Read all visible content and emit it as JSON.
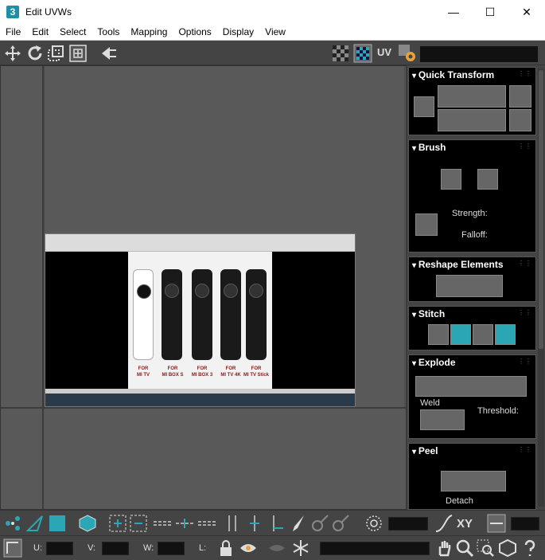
{
  "window": {
    "title": "Edit UVWs",
    "app_icon_letter": "3",
    "minimize": "—",
    "maximize": "☐",
    "close": "✕"
  },
  "menu": [
    "File",
    "Edit",
    "Select",
    "Tools",
    "Mapping",
    "Options",
    "Display",
    "View"
  ],
  "toolbar": {
    "uv_label": "UV"
  },
  "texture": {
    "labels": [
      "FOR\nMI TV",
      "FOR\nMI BOX S",
      "FOR\nMI BOX 3",
      "FOR\nMI TV 4K",
      "FOR\nMI TV Stick"
    ]
  },
  "rollouts": {
    "quick_transform": {
      "title": "Quick Transform"
    },
    "brush": {
      "title": "Brush",
      "strength_label": "Strength:",
      "falloff_label": "Falloff:"
    },
    "reshape": {
      "title": "Reshape Elements"
    },
    "stitch": {
      "title": "Stitch"
    },
    "explode": {
      "title": "Explode",
      "weld_label": "Weld",
      "threshold_label": "Threshold:"
    },
    "peel": {
      "title": "Peel",
      "detach_label": "Detach"
    }
  },
  "bottom": {
    "xy_label": "XY",
    "u_label": "U:",
    "v_label": "V:",
    "w_label": "W:",
    "l_label": "L:"
  },
  "colors": {
    "accent_teal": "#2aa6b5",
    "selection_orange": "#e8a23a",
    "viewport": "#595959"
  }
}
